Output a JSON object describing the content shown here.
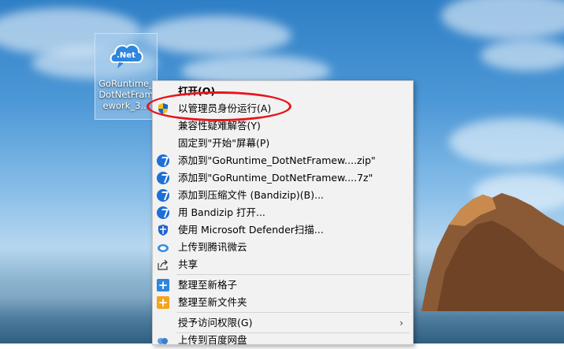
{
  "desktop": {
    "icon": {
      "logo_text": ".Net",
      "label": "GoRuntime_\nDotNetFram\nework_3..."
    }
  },
  "context_menu": {
    "items": [
      {
        "label": "打开(O)",
        "icon": "none",
        "bold": true
      },
      {
        "label": "以管理员身份运行(A)",
        "icon": "uac-shield-icon"
      },
      {
        "label": "兼容性疑难解答(Y)",
        "icon": "none"
      },
      {
        "label": "固定到\"开始\"屏幕(P)",
        "icon": "none"
      },
      {
        "label": "添加到\"GoRuntime_DotNetFramew....zip\"",
        "icon": "bandizip-icon"
      },
      {
        "label": "添加到\"GoRuntime_DotNetFramew....7z\"",
        "icon": "bandizip-icon"
      },
      {
        "label": "添加到压缩文件 (Bandizip)(B)...",
        "icon": "bandizip-icon"
      },
      {
        "label": "用 Bandizip 打开...",
        "icon": "bandizip-icon"
      },
      {
        "label": "使用 Microsoft Defender扫描...",
        "icon": "defender-icon"
      },
      {
        "label": "上传到腾讯微云",
        "icon": "weiyun-icon"
      },
      {
        "label": "共享",
        "icon": "share-icon"
      },
      {
        "label": "整理至新格子",
        "icon": "fences-plus-icon"
      },
      {
        "label": "整理至新文件夹",
        "icon": "fences-folder-icon"
      },
      {
        "label": "授予访问权限(G)",
        "icon": "none",
        "submenu": true
      },
      {
        "label": "上传到百度网盘",
        "icon": "baidu-netdisk-icon"
      }
    ],
    "submenu_arrow": "›"
  },
  "colors": {
    "highlight_circle": "#e8141c",
    "bandizip_blue": "#1d6fd6",
    "fences_orange": "#f3a31d"
  }
}
